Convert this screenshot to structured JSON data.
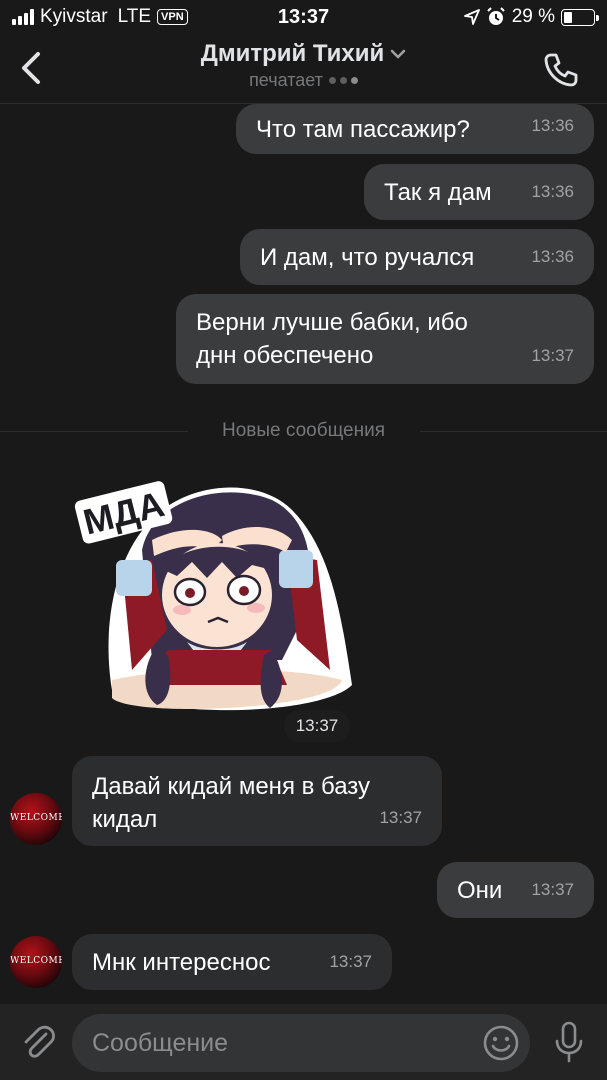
{
  "status_bar": {
    "carrier": "Kyivstar",
    "network": "LTE",
    "vpn": "VPN",
    "time": "13:37",
    "battery": "29 %",
    "battery_level": 0.29
  },
  "header": {
    "contact_name": "Дмитрий Тихий",
    "status": "печатает"
  },
  "messages": [
    {
      "direction": "out",
      "text": "Что там пассажир?",
      "time": "13:36"
    },
    {
      "direction": "out",
      "text": "Так я дам",
      "time": "13:36"
    },
    {
      "direction": "out",
      "text": "И дам, что ручался",
      "time": "13:36"
    },
    {
      "direction": "out",
      "text": "Верни лучше бабки, ибо днн обеспечено",
      "time": "13:37"
    }
  ],
  "divider_label": "Новые сообщения",
  "sticker": {
    "caption": "МДА",
    "time": "13:37"
  },
  "incoming": [
    {
      "direction": "in",
      "text": "Давай кидай меня в базу кидал",
      "time": "13:37",
      "avatar_text": "WELCOME"
    },
    {
      "direction": "out",
      "text": "Они",
      "time": "13:37"
    },
    {
      "direction": "in",
      "text": "Мнк интереснос",
      "time": "13:37",
      "avatar_text": "WELCOME"
    }
  ],
  "input": {
    "placeholder": "Сообщение"
  },
  "colors": {
    "background": "#19191a",
    "bubble": "#3b3c3e",
    "accent": "#e1e3e6"
  }
}
